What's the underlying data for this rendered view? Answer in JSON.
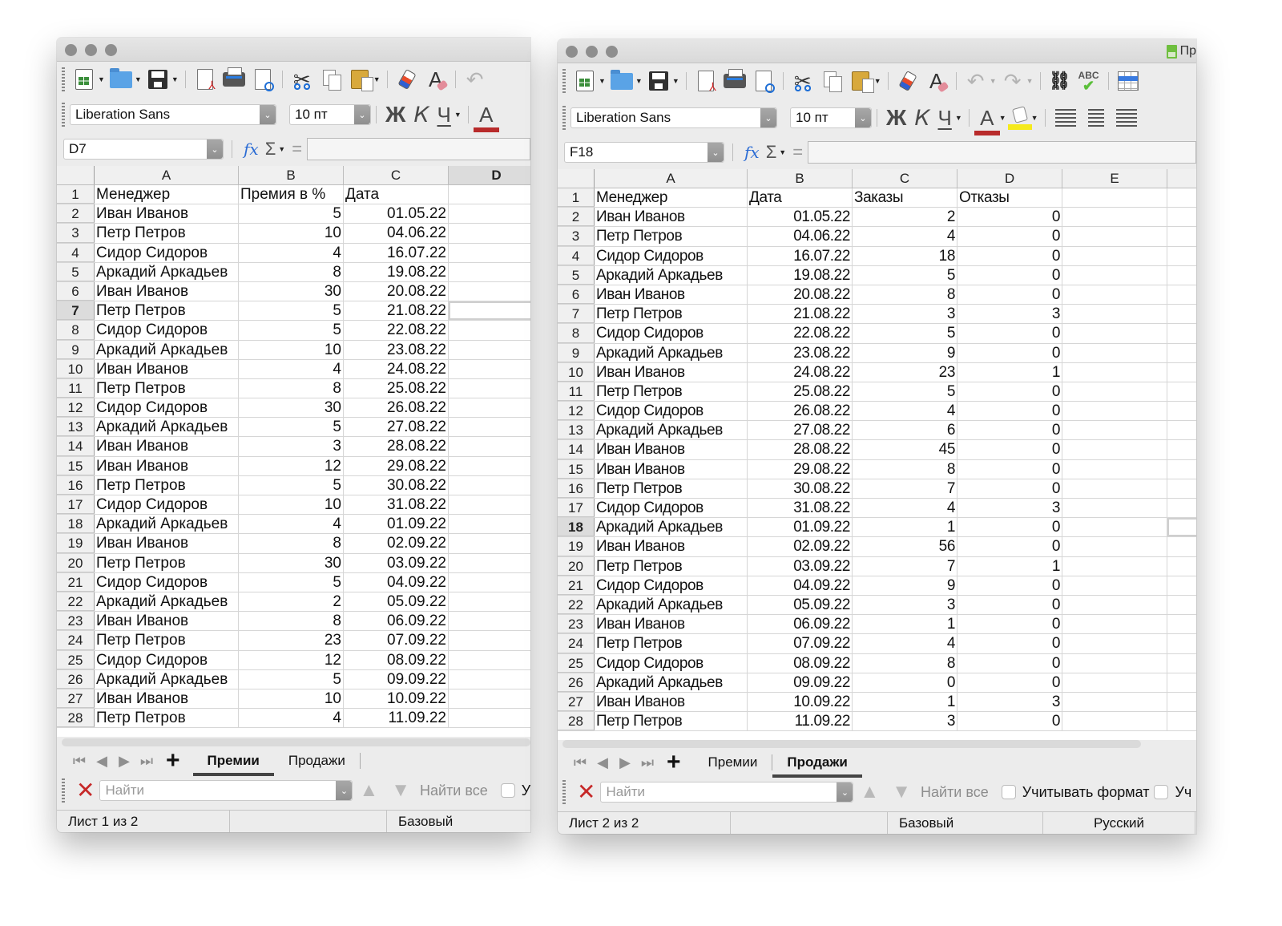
{
  "toolbar": {
    "font_name": "Liberation Sans",
    "font_size": "10 пт",
    "bold_label": "Ж",
    "italic_label": "К",
    "underline_label": "Ч",
    "font_color_label": "А",
    "font_color": "#b82b2b",
    "highlight_color": "#f5ea1c",
    "spell_label": "ABC"
  },
  "formula": {
    "fx_label": "fx",
    "sigma_label": "Σ",
    "equals_label": "="
  },
  "search": {
    "placeholder": "Найти",
    "find_all_label": "Найти все",
    "match_format_label": "Учитывать формат",
    "next_label": "Уч"
  },
  "sheet_tabs": [
    "Премии",
    "Продажи"
  ],
  "left_window": {
    "name_box": "D7",
    "columns": [
      "A",
      "B",
      "C",
      "D"
    ],
    "active_column": "D",
    "active_row": 7,
    "active_tab": "Премии",
    "status_sheet": "Лист 1 из 2",
    "status_style": "Базовый",
    "header_row": [
      "Менеджер",
      "Премия в %",
      "Дата"
    ],
    "rows": [
      [
        "Иван Иванов",
        "5",
        "01.05.22"
      ],
      [
        "Петр Петров",
        "10",
        "04.06.22"
      ],
      [
        "Сидор Сидоров",
        "4",
        "16.07.22"
      ],
      [
        "Аркадий Аркадьев",
        "8",
        "19.08.22"
      ],
      [
        "Иван Иванов",
        "30",
        "20.08.22"
      ],
      [
        "Петр Петров",
        "5",
        "21.08.22"
      ],
      [
        "Сидор Сидоров",
        "5",
        "22.08.22"
      ],
      [
        "Аркадий Аркадьев",
        "10",
        "23.08.22"
      ],
      [
        "Иван Иванов",
        "4",
        "24.08.22"
      ],
      [
        "Петр Петров",
        "8",
        "25.08.22"
      ],
      [
        "Сидор Сидоров",
        "30",
        "26.08.22"
      ],
      [
        "Аркадий Аркадьев",
        "5",
        "27.08.22"
      ],
      [
        "Иван Иванов",
        "3",
        "28.08.22"
      ],
      [
        "Иван Иванов",
        "12",
        "29.08.22"
      ],
      [
        "Петр Петров",
        "5",
        "30.08.22"
      ],
      [
        "Сидор Сидоров",
        "10",
        "31.08.22"
      ],
      [
        "Аркадий Аркадьев",
        "4",
        "01.09.22"
      ],
      [
        "Иван Иванов",
        "8",
        "02.09.22"
      ],
      [
        "Петр Петров",
        "30",
        "03.09.22"
      ],
      [
        "Сидор Сидоров",
        "5",
        "04.09.22"
      ],
      [
        "Аркадий Аркадьев",
        "2",
        "05.09.22"
      ],
      [
        "Иван Иванов",
        "8",
        "06.09.22"
      ],
      [
        "Петр Петров",
        "23",
        "07.09.22"
      ],
      [
        "Сидор Сидоров",
        "12",
        "08.09.22"
      ],
      [
        "Аркадий Аркадьев",
        "5",
        "09.09.22"
      ],
      [
        "Иван Иванов",
        "10",
        "10.09.22"
      ],
      [
        "Петр Петров",
        "4",
        "11.09.22"
      ]
    ]
  },
  "right_window": {
    "title_fragment": "Пр",
    "name_box": "F18",
    "columns": [
      "A",
      "B",
      "C",
      "D",
      "E"
    ],
    "active_row": 18,
    "active_tab": "Продажи",
    "status_sheet": "Лист 2 из 2",
    "status_style": "Базовый",
    "status_language": "Русский",
    "header_row": [
      "Менеджер",
      "Дата",
      "Заказы",
      "Отказы"
    ],
    "rows": [
      [
        "Иван Иванов",
        "01.05.22",
        "2",
        "0"
      ],
      [
        "Петр Петров",
        "04.06.22",
        "4",
        "0"
      ],
      [
        "Сидор Сидоров",
        "16.07.22",
        "18",
        "0"
      ],
      [
        "Аркадий Аркадьев",
        "19.08.22",
        "5",
        "0"
      ],
      [
        "Иван Иванов",
        "20.08.22",
        "8",
        "0"
      ],
      [
        "Петр Петров",
        "21.08.22",
        "3",
        "3"
      ],
      [
        "Сидор Сидоров",
        "22.08.22",
        "5",
        "0"
      ],
      [
        "Аркадий Аркадьев",
        "23.08.22",
        "9",
        "0"
      ],
      [
        "Иван Иванов",
        "24.08.22",
        "23",
        "1"
      ],
      [
        "Петр Петров",
        "25.08.22",
        "5",
        "0"
      ],
      [
        "Сидор Сидоров",
        "26.08.22",
        "4",
        "0"
      ],
      [
        "Аркадий Аркадьев",
        "27.08.22",
        "6",
        "0"
      ],
      [
        "Иван Иванов",
        "28.08.22",
        "45",
        "0"
      ],
      [
        "Иван Иванов",
        "29.08.22",
        "8",
        "0"
      ],
      [
        "Петр Петров",
        "30.08.22",
        "7",
        "0"
      ],
      [
        "Сидор Сидоров",
        "31.08.22",
        "4",
        "3"
      ],
      [
        "Аркадий Аркадьев",
        "01.09.22",
        "1",
        "0"
      ],
      [
        "Иван Иванов",
        "02.09.22",
        "56",
        "0"
      ],
      [
        "Петр Петров",
        "03.09.22",
        "7",
        "1"
      ],
      [
        "Сидор Сидоров",
        "04.09.22",
        "9",
        "0"
      ],
      [
        "Аркадий Аркадьев",
        "05.09.22",
        "3",
        "0"
      ],
      [
        "Иван Иванов",
        "06.09.22",
        "1",
        "0"
      ],
      [
        "Петр Петров",
        "07.09.22",
        "4",
        "0"
      ],
      [
        "Сидор Сидоров",
        "08.09.22",
        "8",
        "0"
      ],
      [
        "Аркадий Аркадьев",
        "09.09.22",
        "0",
        "0"
      ],
      [
        "Иван Иванов",
        "10.09.22",
        "1",
        "3"
      ],
      [
        "Петр Петров",
        "11.09.22",
        "3",
        "0"
      ]
    ]
  }
}
